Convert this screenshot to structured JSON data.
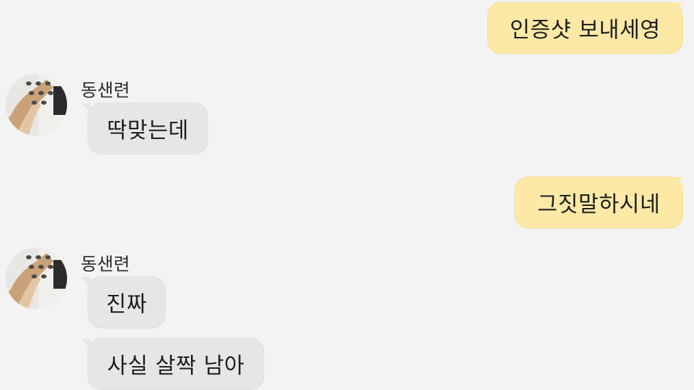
{
  "messages": [
    {
      "side": "mine",
      "text": "인증샷 보내세영"
    },
    {
      "side": "theirs",
      "sender": "동샌련",
      "text": "딱맞는데"
    },
    {
      "side": "mine",
      "text": "그짓말하시네"
    },
    {
      "side": "theirs",
      "sender": "동샌련",
      "text": "진짜"
    },
    {
      "side": "theirs",
      "text": "사실 살짝 남아"
    }
  ],
  "colors": {
    "background": "#f3f3f3",
    "my_bubble": "#fde9a6",
    "their_bubble": "#e6e6e6"
  },
  "icons": {
    "avatar": "profile-photo-icon"
  }
}
